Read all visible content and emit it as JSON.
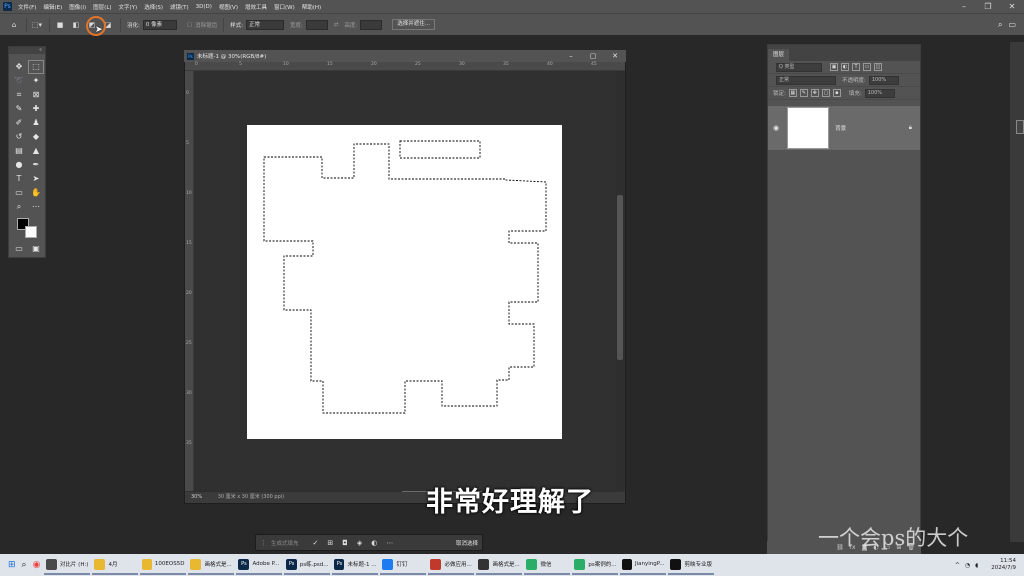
{
  "menubar": {
    "items": [
      "文件(F)",
      "编辑(E)",
      "图像(I)",
      "图层(L)",
      "文字(Y)",
      "选择(S)",
      "滤镜(T)",
      "3D(D)",
      "视图(V)",
      "增效工具",
      "窗口(W)",
      "帮助(H)"
    ],
    "minimize": "–",
    "restore": "❐",
    "close": "✕"
  },
  "options": {
    "feather_label": "羽化:",
    "feather_value": "0 像素",
    "antialias_label": "消除锯齿",
    "style_label": "样式:",
    "style_value": "正常",
    "width_label": "宽度:",
    "height_label": "高度:",
    "select_mask_button": "选择并遮住..."
  },
  "document": {
    "title": "未标题-1 @ 30%(RGB/8#)",
    "zoom": "30%",
    "info": "30 厘米 x 30 厘米 (300 ppi)",
    "ruler_h": [
      "0",
      "5",
      "10",
      "15",
      "20",
      "25",
      "30",
      "35",
      "40",
      "45"
    ],
    "ruler_v": [
      "0",
      "5",
      "10",
      "15",
      "20",
      "25",
      "30",
      "35"
    ]
  },
  "context_bar": {
    "label": "生成式填充",
    "cancel": "取消选择"
  },
  "subtitle": "非常好理解了",
  "layers_panel": {
    "tab": "图层",
    "kind_label": "Q 类型",
    "blend_mode": "正常",
    "opacity_label": "不透明度:",
    "opacity_value": "100%",
    "lock_label": "锁定:",
    "fill_label": "填充:",
    "fill_value": "100%",
    "layer_name": "背景"
  },
  "watermark": "一个会ps的大个",
  "taskbar": {
    "apps": [
      {
        "label": "对比片 (H:)",
        "color": "#4a4a4a"
      },
      {
        "label": "4月",
        "color": "#e8b830"
      },
      {
        "label": "100EOS5D",
        "color": "#e8b830"
      },
      {
        "label": "画格式是...",
        "color": "#e8b830"
      },
      {
        "label": "Adobe P...",
        "color": "#0b2a4a"
      },
      {
        "label": "ps练.psd...",
        "color": "#0b2a4a"
      },
      {
        "label": "未标题-1 ...",
        "color": "#0b2a4a"
      },
      {
        "label": "钉钉",
        "color": "#1e7bf0"
      },
      {
        "label": "必做应用...",
        "color": "#c0392b"
      },
      {
        "label": "画格式是...",
        "color": "#333333"
      },
      {
        "label": "微信",
        "color": "#2aae67"
      },
      {
        "label": "ps案例的...",
        "color": "#2aae67"
      },
      {
        "label": "JianyingP...",
        "color": "#111111"
      },
      {
        "label": "剪映专业版",
        "color": "#111111"
      }
    ],
    "time": "11:54",
    "date": "2024/7/9"
  }
}
